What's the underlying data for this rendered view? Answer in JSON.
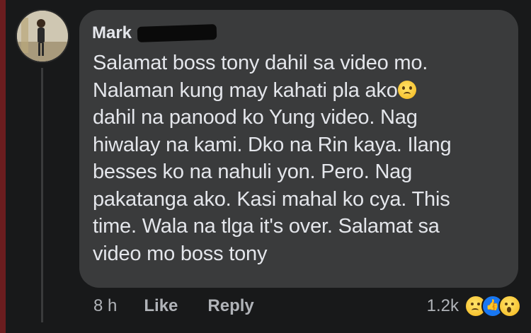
{
  "comment": {
    "author": "Mark",
    "author_avatar_icon": "profile-photo",
    "text_lines": [
      "Salamat boss tony  dahil sa video mo.",
      "Nalaman kung may  kahati pla ako",
      "dahil na panood ko Yung video. Nag",
      "hiwalay na kami. Dko na Rin kaya. Ilang",
      "besses  ko na nahuli yon. Pero. Nag",
      "pakatanga ako. Kasi mahal ko cya. This",
      "time. Wala na tlga it's over. Salamat sa",
      "video mo boss tony"
    ],
    "inline_emoji_icon": "sad-face-emoji"
  },
  "actions": {
    "time": "8 h",
    "like_label": "Like",
    "reply_label": "Reply"
  },
  "reactions": {
    "count": "1.2k",
    "icons": [
      "sad-reaction-icon",
      "like-reaction-icon",
      "wow-reaction-icon"
    ]
  },
  "colors": {
    "background": "#18191a",
    "bubble": "#3a3b3c",
    "text": "#e4e6eb",
    "secondary_text": "#b0b3b8",
    "like_blue": "#1877f2"
  }
}
